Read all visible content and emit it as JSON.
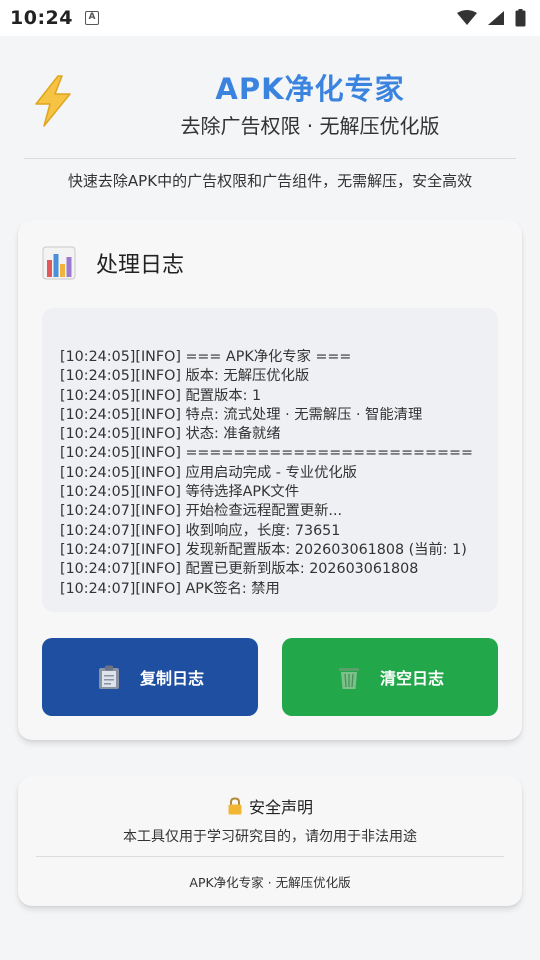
{
  "statusbar": {
    "time": "10:24",
    "notif_icon": "a-icon"
  },
  "header": {
    "title": "APK净化专家",
    "subtitle": "去除广告权限 · 无解压优化版",
    "description": "快速去除APK中的广告权限和广告组件，无需解压，安全高效"
  },
  "log": {
    "title": "处理日志",
    "lines": [
      "[10:24:05][INFO] === APK净化专家 ===",
      "[10:24:05][INFO] 版本: 无解压优化版",
      "[10:24:05][INFO] 配置版本: 1",
      "[10:24:05][INFO] 特点: 流式处理 · 无需解压 · 智能清理",
      "[10:24:05][INFO] 状态: 准备就绪",
      "[10:24:05][INFO] ========================",
      "[10:24:05][INFO] 应用启动完成 - 专业优化版",
      "[10:24:05][INFO] 等待选择APK文件",
      "[10:24:07][INFO] 开始检查远程配置更新...",
      "[10:24:07][INFO] 收到响应，长度: 73651",
      "[10:24:07][INFO] 发现新配置版本: 202603061808 (当前: 1)",
      "[10:24:07][INFO] 配置已更新到版本: 202603061808",
      "[10:24:07][INFO] APK签名: 禁用"
    ],
    "copy_label": "复制日志",
    "clear_label": "清空日志"
  },
  "notice": {
    "title": "安全声明",
    "text": "本工具仅用于学习研究目的，请勿用于非法用途",
    "footer": "APK净化专家 · 无解压优化版"
  },
  "colors": {
    "title_blue": "#3a84e0",
    "copy_button": "#1f4fa0",
    "clear_button": "#22a84a",
    "background": "#f4f5f7"
  }
}
